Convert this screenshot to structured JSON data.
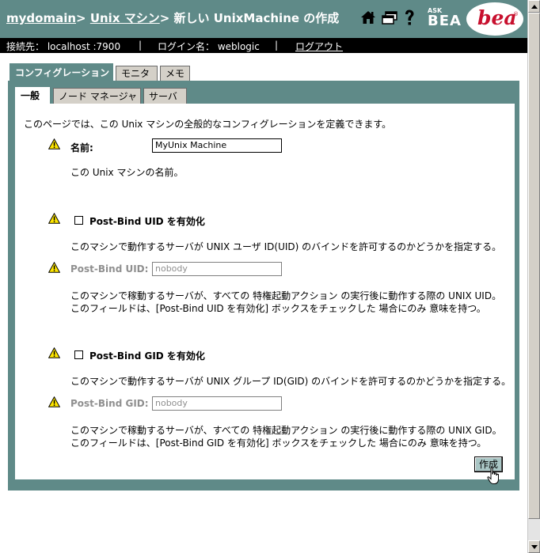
{
  "header": {
    "breadcrumb": {
      "domain": "mydomain",
      "sep1": "> ",
      "machines": "Unix マシン",
      "sep2": "> ",
      "current": "新しい UnixMachine の作成"
    },
    "icons": [
      "home-icon",
      "windows-icon",
      "help-icon"
    ],
    "ask_bea": {
      "ask": "ASK",
      "bea": "BEA"
    },
    "logo_text": "bea",
    "logo_mark": "®"
  },
  "status_bar": {
    "connection": "接続先： localhost :7900",
    "sep1": "|",
    "login": "ログイン名： weblogic",
    "sep2": "|",
    "logout": "ログアウト"
  },
  "tabs": {
    "main": [
      "コンフィグレーション",
      "モニタ",
      "メモ"
    ],
    "sub": [
      "一般",
      "ノード マネージャ",
      "サーバ"
    ]
  },
  "form": {
    "intro": "このページでは、この Unix マシンの全般的なコンフィグレーションを定義できます。",
    "name": {
      "label": "名前:",
      "value": "MyUnix Machine",
      "help": "この Unix マシンの名前。"
    },
    "uid_enable": {
      "label": "Post-Bind UID を有効化",
      "checked": false,
      "help": "このマシンで動作するサーバが UNIX ユーザ ID(UID) のバインドを許可するのかどうかを指定する。"
    },
    "uid": {
      "label": "Post-Bind UID:",
      "value": "nobody",
      "help1": "このマシンで稼動するサーバが、すべての 特権起動アクション の実行後に動作する際の UNIX UID。",
      "help2": "このフィールドは、[Post-Bind UID を有効化] ボックスをチェックした 場合にのみ 意味を持つ。"
    },
    "gid_enable": {
      "label": "Post-Bind GID を有効化",
      "checked": false,
      "help": "このマシンで動作するサーバが UNIX グループ ID(GID) のバインドを許可するのかどうかを指定する。"
    },
    "gid": {
      "label": "Post-Bind GID:",
      "value": "nobody",
      "help1": "このマシンで稼動するサーバが、すべての 特権起動アクション の実行後に動作する際の UNIX GID。",
      "help2": "このフィールドは、[Post-Bind GID を有効化] ボックスをチェックした 場合にのみ 意味を持つ。"
    },
    "create_button": "作成"
  },
  "colors": {
    "header_bg": "#5f8a88",
    "status_bg": "#000000",
    "button_bg": "#a9c6c5",
    "logo_red": "#c8102e"
  }
}
